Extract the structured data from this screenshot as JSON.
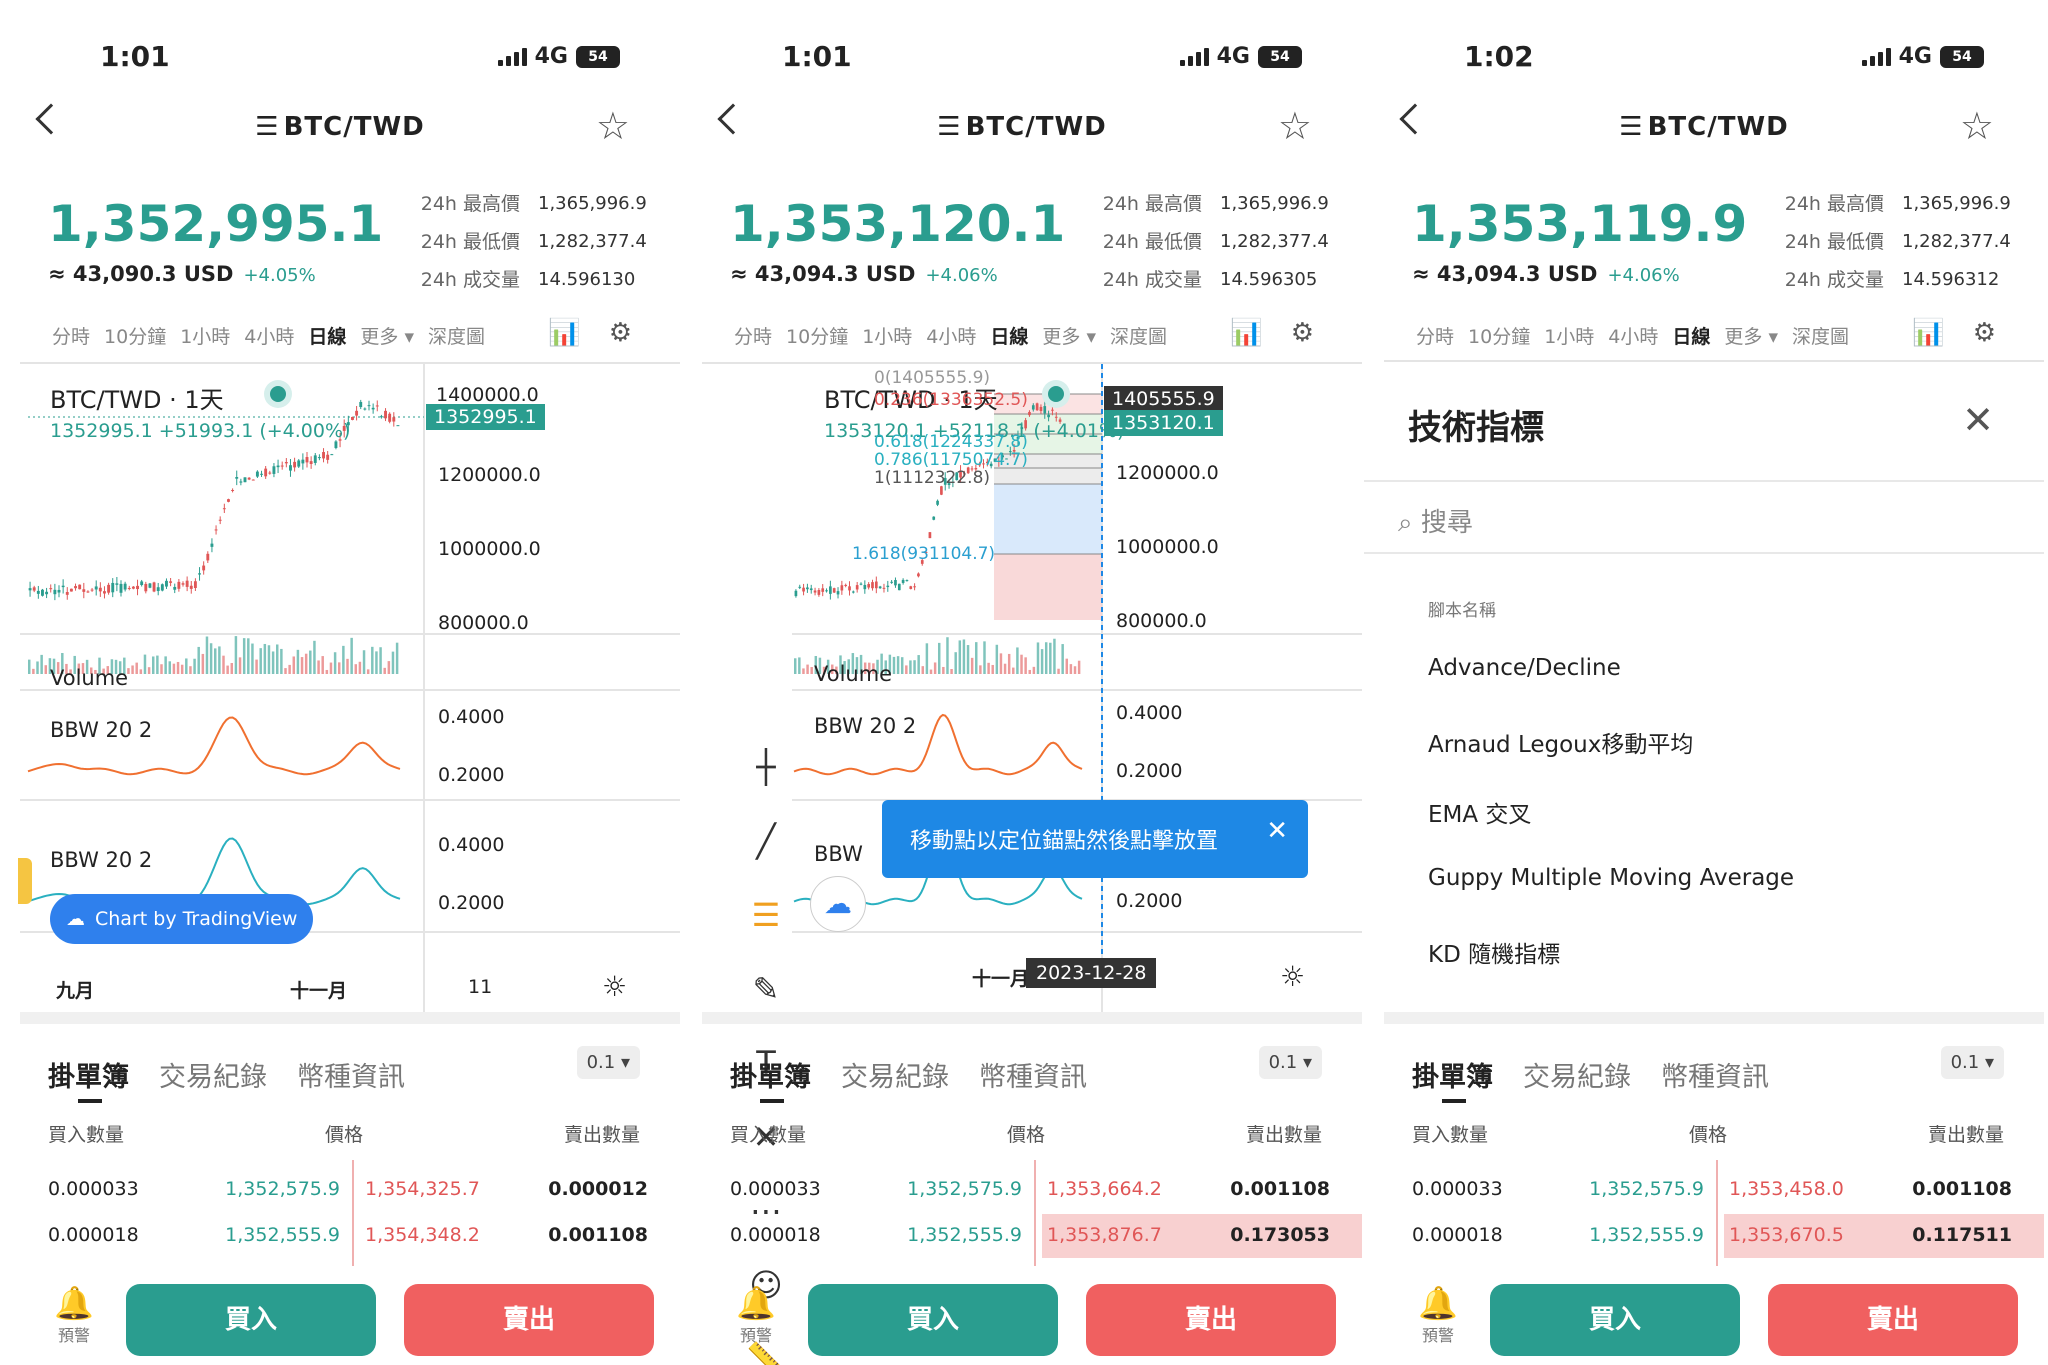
{
  "colors": {
    "up": "#2a9d8f",
    "down": "#e05656",
    "accent": "#1e88e5"
  },
  "phones": [
    {
      "status_time": "1:01",
      "network": "4G",
      "battery": "54",
      "pair": "BTC/TWD",
      "price": "1,352,995.1",
      "usd": "≈ 43,090.3 USD",
      "change": "+4.05%",
      "stats": [
        {
          "k": "24h 最高價",
          "v": "1,365,996.9"
        },
        {
          "k": "24h 最低價",
          "v": "1,282,377.4"
        },
        {
          "k": "24h 成交量",
          "v": "14.596130"
        }
      ],
      "chart": {
        "legend_title": "BTC/TWD · 1天",
        "legend_values": "1352995.1  +51993.1 (+4.00%)",
        "last_price_tag": "1352995.1",
        "top_tag": "1400000.0",
        "y_ticks": [
          "1200000.0",
          "1000000.0",
          "800000.0"
        ],
        "volume_label": "Volume",
        "bbw1_label": "BBW 20 2",
        "bbw1_ticks": [
          "0.4000",
          "0.2000"
        ],
        "bbw2_label": "BBW 20 2",
        "bbw2_ticks": [
          "0.4000",
          "0.2000"
        ],
        "x_ticks": [
          "九月",
          "十一月",
          "11"
        ],
        "badge": "Chart by TradingView"
      },
      "orderbook": {
        "rows": [
          {
            "bid_qty": "0.000033",
            "bid": "1,352,575.9",
            "ask": "1,354,325.7",
            "ask_qty": "0.000012",
            "hl": false
          },
          {
            "bid_qty": "0.000018",
            "bid": "1,352,555.9",
            "ask": "1,354,348.2",
            "ask_qty": "0.001108",
            "hl": false
          }
        ]
      },
      "alert_label": "預警"
    },
    {
      "status_time": "1:01",
      "network": "4G",
      "battery": "54",
      "pair": "BTC/TWD",
      "price": "1,353,120.1",
      "usd": "≈ 43,094.3 USD",
      "change": "+4.06%",
      "stats": [
        {
          "k": "24h 最高價",
          "v": "1,365,996.9"
        },
        {
          "k": "24h 最低價",
          "v": "1,282,377.4"
        },
        {
          "k": "24h 成交量",
          "v": "14.596305"
        }
      ],
      "chart": {
        "legend_title": "BTC/TWD · 1天",
        "legend_values": "1353120.1 +52118.1 (+4.01%)",
        "last_price_tag": "1353120.1",
        "top_tag": "1405555.9",
        "y_ticks": [
          "1200000.0",
          "1000000.0",
          "800000.0"
        ],
        "volume_label": "Volume",
        "bbw1_label": "BBW 20 2",
        "bbw1_ticks": [
          "0.4000",
          "0.2000"
        ],
        "bbw2_label": "BBW",
        "bbw2_ticks": [
          "0.2000"
        ],
        "fib": [
          "0(1405555.9)",
          "0.236(1336352.5)",
          "0.618(1224337.8)",
          "0.786(1175074.7)",
          "1(1112322.8)",
          "1.618(931104.7)"
        ],
        "x_ticks": [
          "十一月"
        ],
        "date_tag": "2023-12-28",
        "toast": "移動點以定位錨點然後點擊放置"
      },
      "orderbook": {
        "rows": [
          {
            "bid_qty": "0.000033",
            "bid": "1,352,575.9",
            "ask": "1,353,664.2",
            "ask_qty": "0.001108",
            "hl": false
          },
          {
            "bid_qty": "0.000018",
            "bid": "1,352,555.9",
            "ask": "1,353,876.7",
            "ask_qty": "0.173053",
            "hl": true
          }
        ]
      },
      "alert_label": "預警"
    },
    {
      "status_time": "1:02",
      "network": "4G",
      "battery": "54",
      "pair": "BTC/TWD",
      "price": "1,353,119.9",
      "usd": "≈ 43,094.3 USD",
      "change": "+4.06%",
      "stats": [
        {
          "k": "24h 最高價",
          "v": "1,365,996.9"
        },
        {
          "k": "24h 最低價",
          "v": "1,282,377.4"
        },
        {
          "k": "24h 成交量",
          "v": "14.596312"
        }
      ],
      "indicators": {
        "title": "技術指標",
        "search_placeholder": "搜尋",
        "section": "腳本名稱",
        "items": [
          "Advance/Decline",
          "Arnaud Legoux移動平均",
          "EMA 交叉",
          "Guppy Multiple Moving Average",
          "KD 隨機指標"
        ]
      },
      "orderbook": {
        "rows": [
          {
            "bid_qty": "0.000033",
            "bid": "1,352,575.9",
            "ask": "1,353,458.0",
            "ask_qty": "0.001108",
            "hl": false
          },
          {
            "bid_qty": "0.000018",
            "bid": "1,352,555.9",
            "ask": "1,353,670.5",
            "ask_qty": "0.117511",
            "hl": true
          }
        ]
      },
      "alert_label": "預警"
    }
  ],
  "common": {
    "timeframes": [
      "分時",
      "10分鐘",
      "1小時",
      "4小時",
      "日線",
      "更多 ▾",
      "深度圖"
    ],
    "active_timeframe": "日線",
    "ob_tabs": [
      "掛單簿",
      "交易紀錄",
      "幣種資訊"
    ],
    "ob_depth": "0.1 ▾",
    "ob_headers": [
      "買入數量",
      "價格",
      "賣出數量"
    ],
    "buy": "買入",
    "sell": "賣出"
  }
}
